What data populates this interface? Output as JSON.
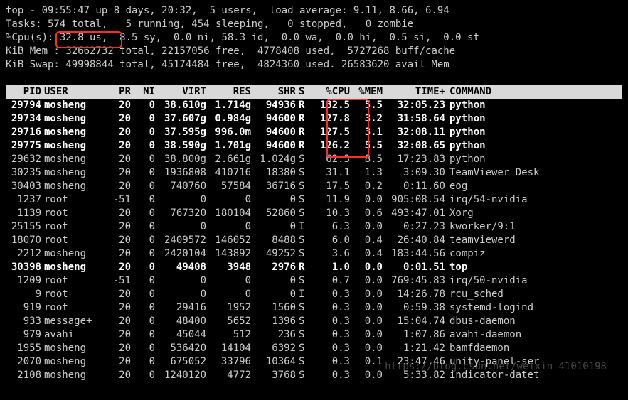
{
  "summary": {
    "line1": "top - 09:55:47 up 8 days, 20:32,  5 users,  load average: 9.11, 8.66, 6.94",
    "line2": "Tasks: 574 total,   5 running, 454 sleeping,   0 stopped,   0 zombie",
    "line3_pre": "%Cpu(s): ",
    "line3_us": "32.8 us,",
    "line3_post": "  8.5 sy,  0.0 ni, 58.3 id,  0.0 wa,  0.0 hi,  0.5 si,  0.0 st",
    "line4": "KiB Mem : 32662732 total, 22157056 free,  4778408 used,  5727268 buff/cache",
    "line5": "KiB Swap: 49998844 total, 45174484 free,  4824360 used. 26583620 avail Mem"
  },
  "columns": {
    "pid": "PID",
    "user": "USER",
    "pr": "PR",
    "ni": "NI",
    "virt": "VIRT",
    "res": "RES",
    "shr": "SHR",
    "s": "S",
    "cpu": "%CPU",
    "mem": "%MEM",
    "time": "TIME+",
    "cmd": "COMMAND"
  },
  "rows": [
    {
      "pid": "29794",
      "user": "mosheng",
      "pr": "20",
      "ni": "0",
      "virt": "38.610g",
      "res": "1.714g",
      "shr": "94936",
      "s": "R",
      "cpu": "132.5",
      "mem": "5.5",
      "time": "32:05.23",
      "cmd": "python",
      "bold": true
    },
    {
      "pid": "29734",
      "user": "mosheng",
      "pr": "20",
      "ni": "0",
      "virt": "37.607g",
      "res": "0.984g",
      "shr": "94600",
      "s": "R",
      "cpu": "127.8",
      "mem": "3.2",
      "time": "31:58.64",
      "cmd": "python",
      "bold": true
    },
    {
      "pid": "29716",
      "user": "mosheng",
      "pr": "20",
      "ni": "0",
      "virt": "37.595g",
      "res": "996.0m",
      "shr": "94600",
      "s": "R",
      "cpu": "127.5",
      "mem": "3.1",
      "time": "32:08.11",
      "cmd": "python",
      "bold": true
    },
    {
      "pid": "29775",
      "user": "mosheng",
      "pr": "20",
      "ni": "0",
      "virt": "38.590g",
      "res": "1.701g",
      "shr": "94600",
      "s": "R",
      "cpu": "126.2",
      "mem": "5.5",
      "time": "32:08.65",
      "cmd": "python",
      "bold": true
    },
    {
      "pid": "29632",
      "user": "mosheng",
      "pr": "20",
      "ni": "0",
      "virt": "38.800g",
      "res": "2.661g",
      "shr": "1.024g",
      "s": "S",
      "cpu": "62.3",
      "mem": "8.5",
      "time": "17:23.83",
      "cmd": "python"
    },
    {
      "pid": "30235",
      "user": "mosheng",
      "pr": "20",
      "ni": "0",
      "virt": "1936808",
      "res": "410716",
      "shr": "18380",
      "s": "S",
      "cpu": "31.1",
      "mem": "1.3",
      "time": "3:09.30",
      "cmd": "TeamViewer_Desk"
    },
    {
      "pid": "30403",
      "user": "mosheng",
      "pr": "20",
      "ni": "0",
      "virt": "740760",
      "res": "57584",
      "shr": "36716",
      "s": "S",
      "cpu": "17.5",
      "mem": "0.2",
      "time": "0:11.60",
      "cmd": "eog"
    },
    {
      "pid": "1237",
      "user": "root",
      "pr": "-51",
      "ni": "0",
      "virt": "0",
      "res": "0",
      "shr": "0",
      "s": "S",
      "cpu": "11.9",
      "mem": "0.0",
      "time": "905:08.54",
      "cmd": "irq/54-nvidia"
    },
    {
      "pid": "1139",
      "user": "root",
      "pr": "20",
      "ni": "0",
      "virt": "767320",
      "res": "180104",
      "shr": "52860",
      "s": "S",
      "cpu": "10.3",
      "mem": "0.6",
      "time": "493:47.01",
      "cmd": "Xorg"
    },
    {
      "pid": "25155",
      "user": "root",
      "pr": "20",
      "ni": "0",
      "virt": "0",
      "res": "0",
      "shr": "0",
      "s": "I",
      "cpu": "6.3",
      "mem": "0.0",
      "time": "0:27.23",
      "cmd": "kworker/9:1"
    },
    {
      "pid": "18070",
      "user": "root",
      "pr": "20",
      "ni": "0",
      "virt": "2409572",
      "res": "146052",
      "shr": "8488",
      "s": "S",
      "cpu": "6.0",
      "mem": "0.4",
      "time": "26:40.84",
      "cmd": "teamviewerd"
    },
    {
      "pid": "2212",
      "user": "mosheng",
      "pr": "20",
      "ni": "0",
      "virt": "2420104",
      "res": "143892",
      "shr": "49252",
      "s": "S",
      "cpu": "3.6",
      "mem": "0.4",
      "time": "183:44.56",
      "cmd": "compiz"
    },
    {
      "pid": "30398",
      "user": "mosheng",
      "pr": "20",
      "ni": "0",
      "virt": "49408",
      "res": "3948",
      "shr": "2976",
      "s": "R",
      "cpu": "1.0",
      "mem": "0.0",
      "time": "0:01.51",
      "cmd": "top",
      "bold": true
    },
    {
      "pid": "1209",
      "user": "root",
      "pr": "-51",
      "ni": "0",
      "virt": "0",
      "res": "0",
      "shr": "0",
      "s": "S",
      "cpu": "0.7",
      "mem": "0.0",
      "time": "769:45.83",
      "cmd": "irq/50-nvidia"
    },
    {
      "pid": "9",
      "user": "root",
      "pr": "20",
      "ni": "0",
      "virt": "0",
      "res": "0",
      "shr": "0",
      "s": "I",
      "cpu": "0.3",
      "mem": "0.0",
      "time": "14:26.78",
      "cmd": "rcu_sched"
    },
    {
      "pid": "919",
      "user": "root",
      "pr": "20",
      "ni": "0",
      "virt": "29416",
      "res": "1952",
      "shr": "1560",
      "s": "S",
      "cpu": "0.3",
      "mem": "0.0",
      "time": "0:59.38",
      "cmd": "systemd-logind"
    },
    {
      "pid": "933",
      "user": "message+",
      "pr": "20",
      "ni": "0",
      "virt": "48400",
      "res": "5652",
      "shr": "1396",
      "s": "S",
      "cpu": "0.3",
      "mem": "0.0",
      "time": "15:04.74",
      "cmd": "dbus-daemon"
    },
    {
      "pid": "979",
      "user": "avahi",
      "pr": "20",
      "ni": "0",
      "virt": "45044",
      "res": "512",
      "shr": "236",
      "s": "S",
      "cpu": "0.3",
      "mem": "0.0",
      "time": "1:07.86",
      "cmd": "avahi-daemon"
    },
    {
      "pid": "1955",
      "user": "mosheng",
      "pr": "20",
      "ni": "0",
      "virt": "536420",
      "res": "14104",
      "shr": "6392",
      "s": "S",
      "cpu": "0.3",
      "mem": "0.0",
      "time": "1:21.42",
      "cmd": "bamfdaemon"
    },
    {
      "pid": "2070",
      "user": "mosheng",
      "pr": "20",
      "ni": "0",
      "virt": "675052",
      "res": "33796",
      "shr": "10364",
      "s": "S",
      "cpu": "0.3",
      "mem": "0.1",
      "time": "23:47.46",
      "cmd": "unity-panel-ser"
    },
    {
      "pid": "2108",
      "user": "mosheng",
      "pr": "20",
      "ni": "0",
      "virt": "1240120",
      "res": "4772",
      "shr": "3768",
      "s": "S",
      "cpu": "0.3",
      "mem": "0.0",
      "time": "5:33.82",
      "cmd": "indicator-datet"
    }
  ],
  "watermark": "https://blog.csdn.net/weixin_41010198"
}
